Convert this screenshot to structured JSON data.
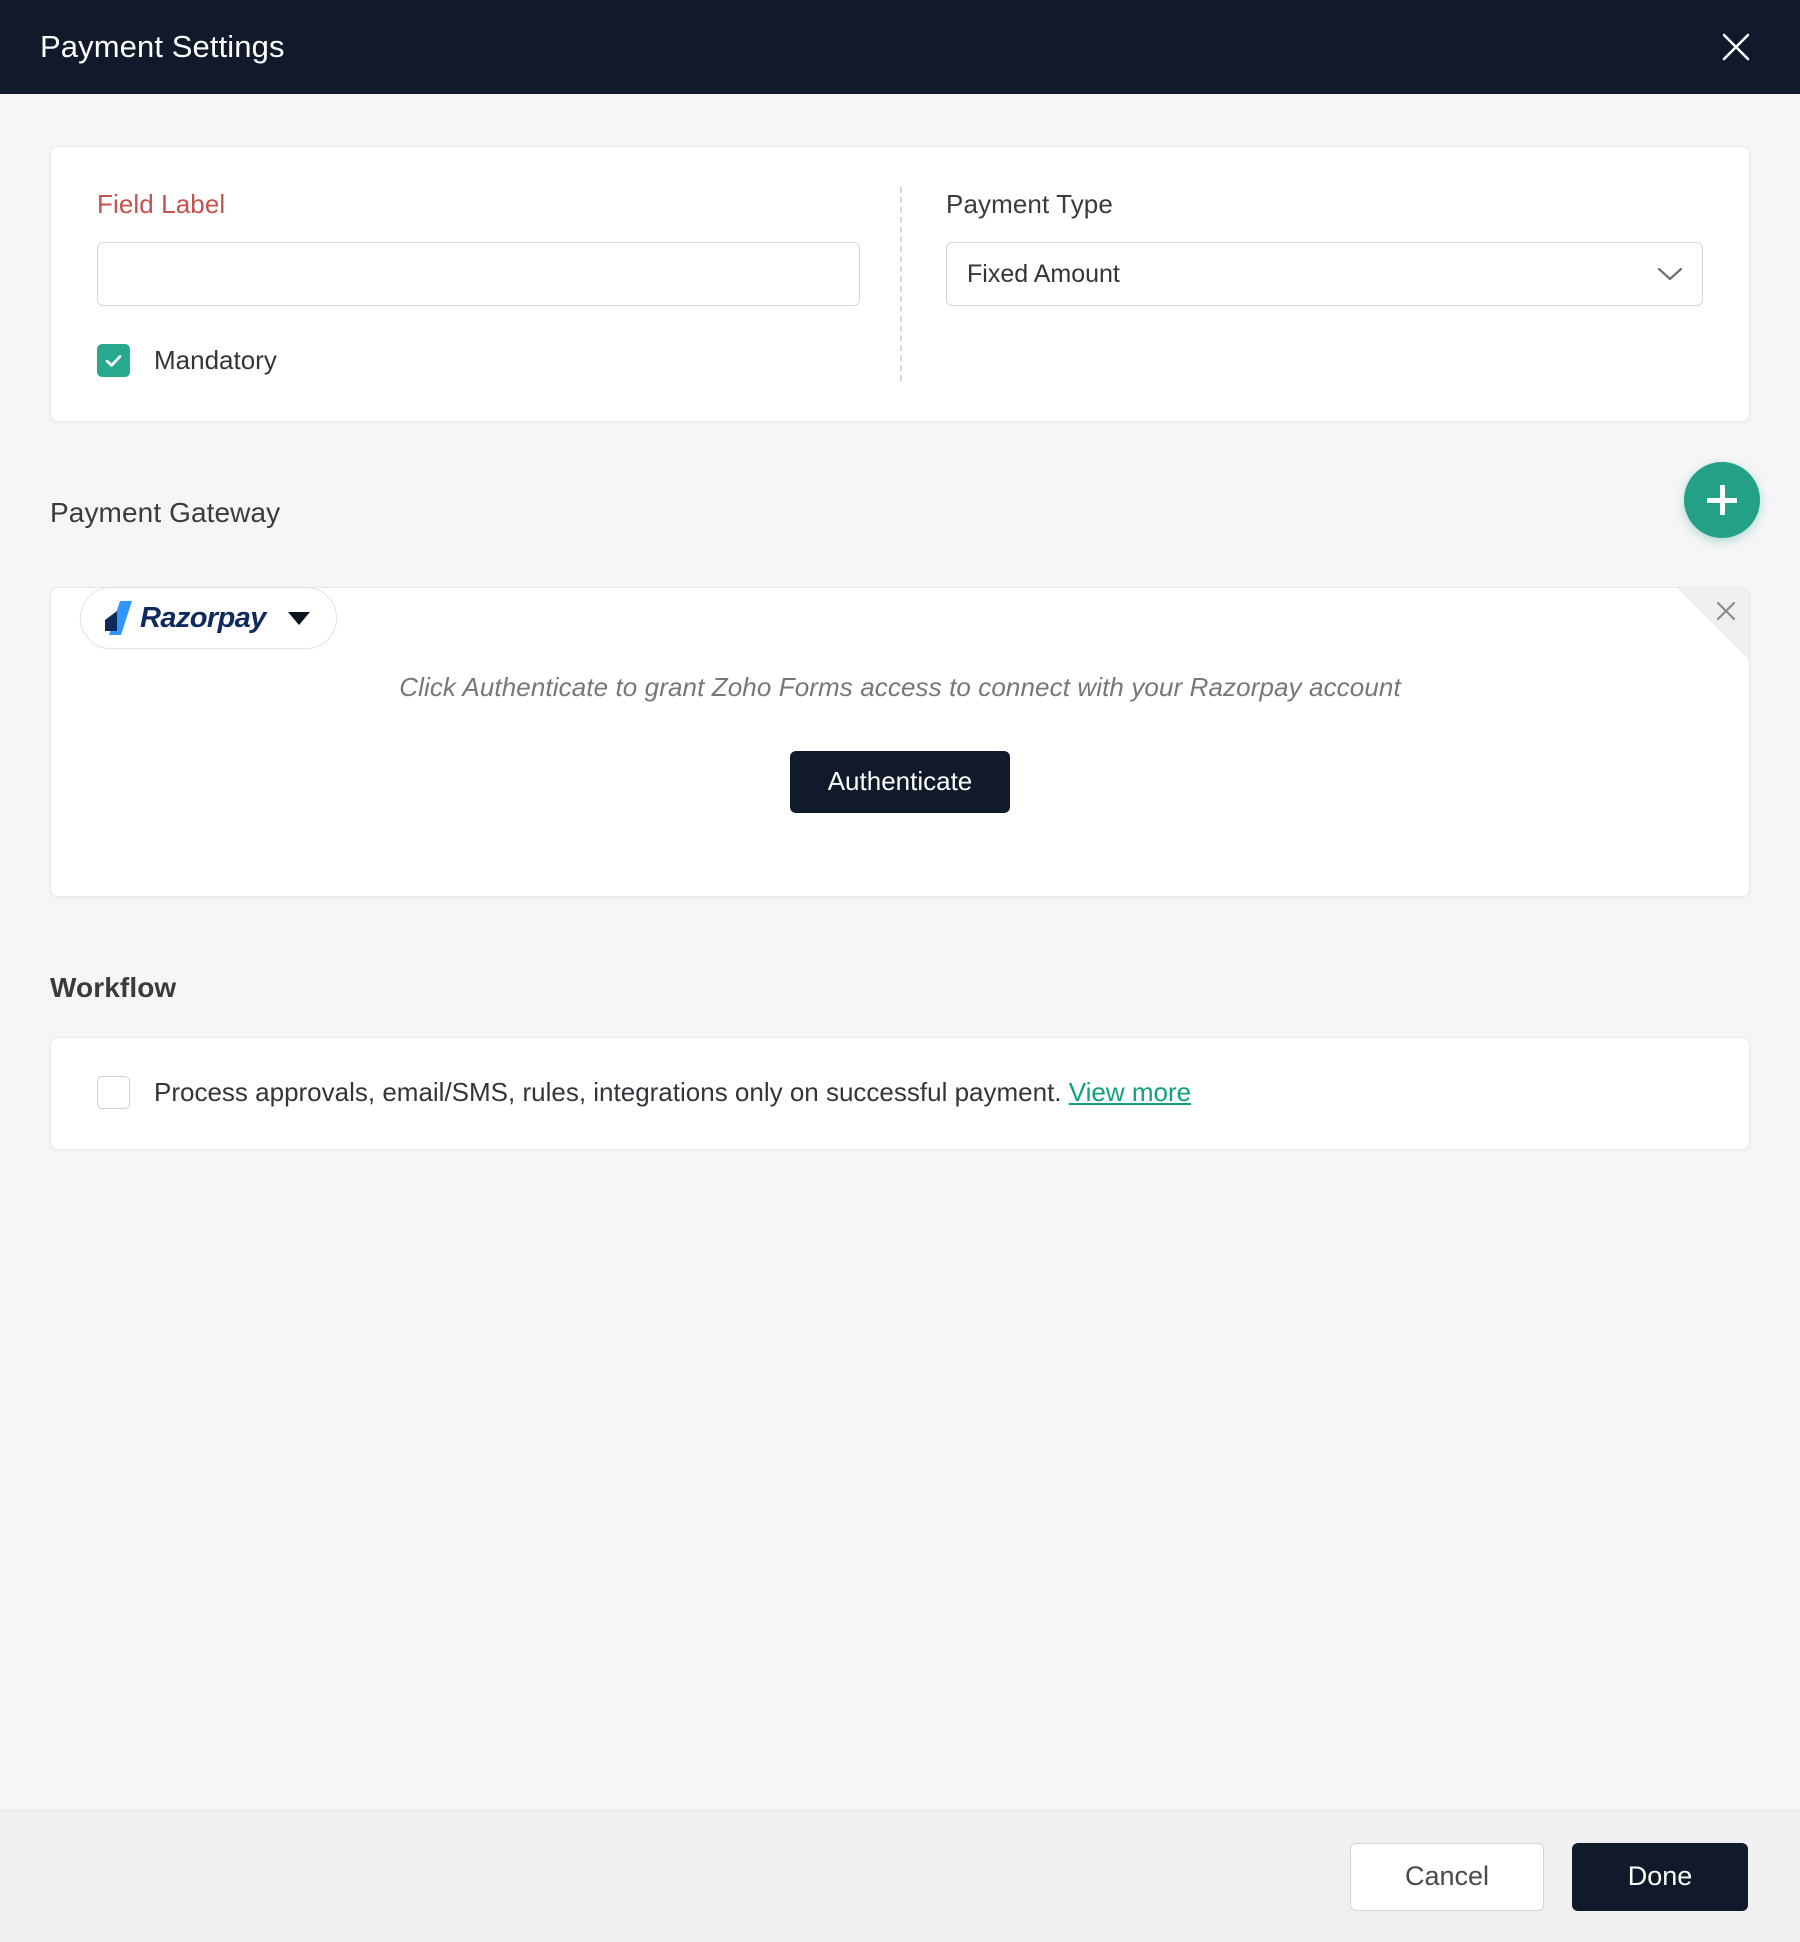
{
  "header": {
    "title": "Payment Settings",
    "close_icon": "close-icon"
  },
  "field_section": {
    "field_label": {
      "label": "Field Label",
      "value": "",
      "placeholder": "",
      "required_color": "#c4524f"
    },
    "mandatory": {
      "label": "Mandatory",
      "checked": true,
      "check_color": "#27a98d"
    },
    "payment_type": {
      "label": "Payment Type",
      "selected": "Fixed Amount",
      "chevron_icon": "chevron-down-icon"
    }
  },
  "payment_gateway": {
    "title": "Payment Gateway",
    "add_button": {
      "icon": "plus-icon",
      "color": "#23a085"
    },
    "tab": {
      "name": "Razorpay",
      "logo_icon": "razorpay-logo-icon",
      "logo_colors": {
        "mark_dark": "#12295c",
        "mark_light": "#3395ff",
        "word": "#0f2a5f"
      },
      "caret_icon": "caret-down-icon"
    },
    "card": {
      "message": "Click Authenticate to grant Zoho Forms access to connect with your Razorpay account",
      "authenticate_label": "Authenticate",
      "remove_icon": "close-icon"
    }
  },
  "workflow": {
    "title": "Workflow",
    "checkbox": {
      "checked": false,
      "text": "Process approvals, email/SMS, rules, integrations only on successful payment.",
      "link_label": "View more",
      "link_color": "#14a07e"
    }
  },
  "footer": {
    "cancel_label": "Cancel",
    "done_label": "Done"
  }
}
